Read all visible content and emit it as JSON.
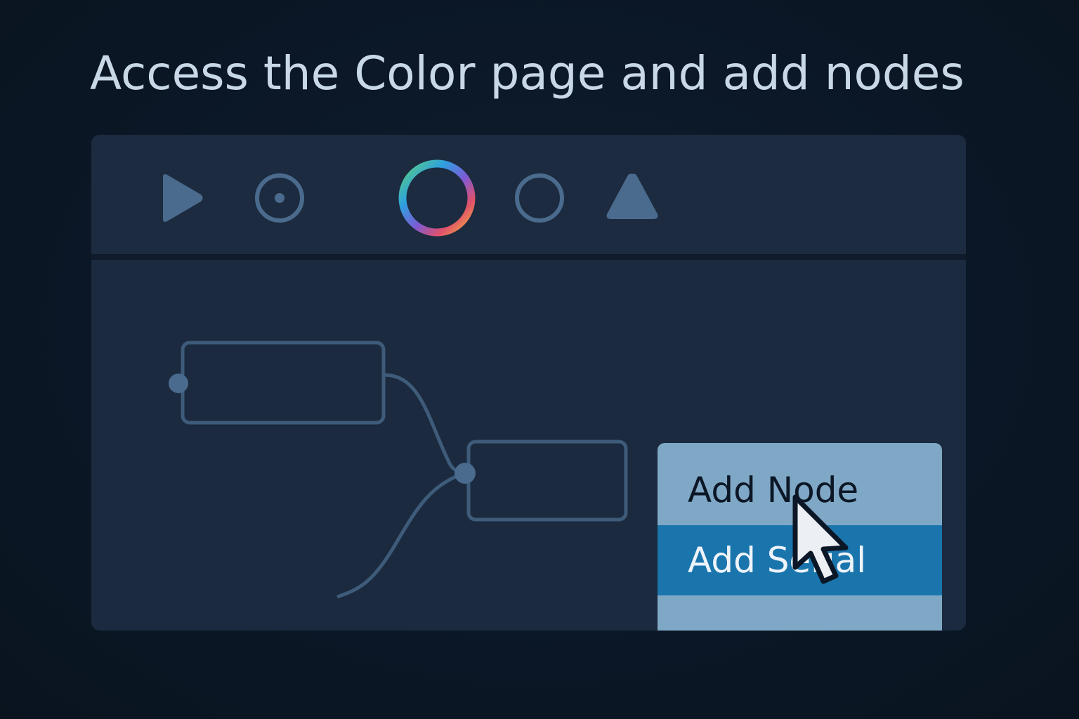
{
  "title": "Access the Color page and add nodes",
  "toolbar": {
    "icons": [
      {
        "name": "play-icon",
        "color": "#4a6b8d"
      },
      {
        "name": "record-icon",
        "color": "#4a6b8d"
      },
      {
        "name": "color-page-icon",
        "active": true,
        "colors": [
          "#2ea0e0",
          "#7b5bd6",
          "#e0516b",
          "#f3b43b",
          "#5bd07a"
        ]
      },
      {
        "name": "circle-icon",
        "color": "#4a6b8d"
      },
      {
        "name": "triangle-icon",
        "color": "#4a6b8d"
      }
    ]
  },
  "context_menu": {
    "items": [
      {
        "label": "Add Node",
        "highlighted": false
      },
      {
        "label": "Add Serial",
        "highlighted": true
      }
    ]
  },
  "colors": {
    "background": "#0b1726",
    "panel": "#1b2a3e",
    "node_stroke": "#4a6b8d",
    "menu_bg": "#7fa8c6",
    "menu_highlight": "#1b75ad",
    "title_text": "#c9d8e6"
  }
}
